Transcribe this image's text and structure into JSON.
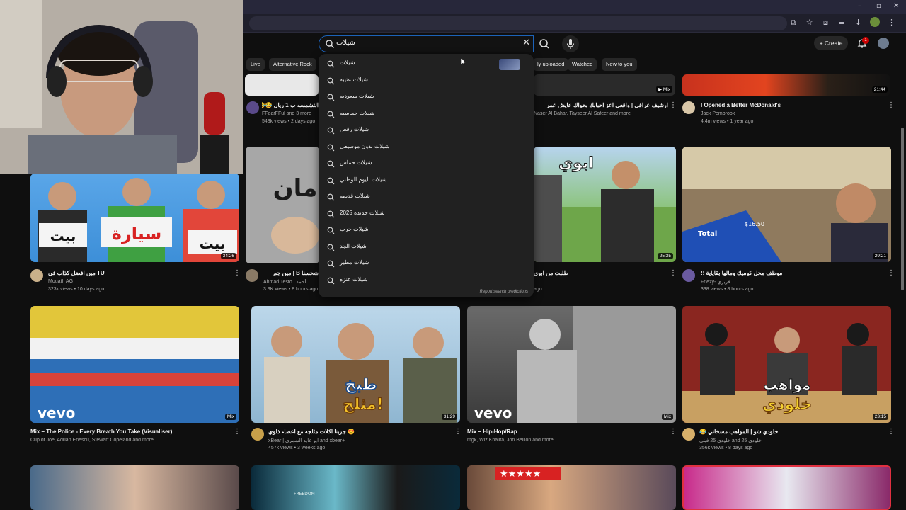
{
  "header": {
    "search_query": "شيلات",
    "create_label": "Create",
    "notification_count": "1"
  },
  "chips": [
    "Live",
    "Alternative Rock",
    "ly uploaded",
    "Watched",
    "New to you"
  ],
  "suggestions": [
    "شيلات",
    "شيلات عتيبه",
    "شيلات سعوديه",
    "شيلات حماسيه",
    "شيلات رقص",
    "شيلات بدون موسيقى",
    "شيلات حماس",
    "شيلات اليوم الوطني",
    "شيلات قديمه",
    "شيلات جديده 2025",
    "شيلات حرب",
    "شيلات الجد",
    "شيلات مطير",
    "شيلات عنزه"
  ],
  "report_label": "Report search predictions",
  "row1": [
    {
      "title": "التشمسه ب 1 ريال 😂😂",
      "channel": "FFearFFul and 3 more",
      "meta": "543k views • 2 days ago"
    },
    {
      "title": "ارشيف عراقي | واقعي اعز احبابك بحواك عايش عمر",
      "channel": "Naser Al Bahar, Tayseer Al Safeer and more",
      "meta": ""
    },
    {
      "title": "I Opened a Better McDonald's",
      "channel": "Jack Pembrook",
      "meta": "4.4m views • 1 year ago"
    }
  ],
  "row2": [
    {
      "title": "مين افضل كذاب في TU",
      "channel": "Mouath AG",
      "meta": "323k views • 10 days ago",
      "duration": "34:26"
    },
    {
      "title": "شحسنا B | مين جم",
      "channel": "Ahmad Testo | أحمد",
      "meta": "3.9K views • 8 hours ago"
    },
    {
      "title": "طلبت من ابوي",
      "channel": "",
      "meta": "ago",
      "duration": "25:35"
    },
    {
      "title": "موظف محل كوميك ومالها بقاياية !!",
      "channel": "Friezy- فريزي",
      "meta": "338 views • 8 hours ago",
      "duration": "29:21"
    }
  ],
  "row3": [
    {
      "title": "Mix – The Police - Every Breath You Take (Visualiser)",
      "channel": "Cup of Joe, Adrian Enescu, Stewart Copeland and more",
      "meta": "",
      "badge": "Mix"
    },
    {
      "title": "😍 جربنا اكلات مثلجه مع اعضاء ذلوي",
      "channel": "xBear | ابو عابد الشمري and xbear+",
      "meta": "457k views • 3 weeks ago",
      "duration": "31:29"
    },
    {
      "title": "Mix – Hip-Hop/Rap",
      "channel": "mgk, Wiz Khalifa, Jon Bellion and more",
      "meta": "",
      "badge": "Mix"
    },
    {
      "title": "خلودي شو | المواهب مسخاني 😂",
      "channel": "خلودي 25 فيني and 25 خلودي",
      "meta": "356k views • 8 days ago",
      "duration": "23:15"
    }
  ],
  "thumb_texts": {
    "bait": "بيت",
    "sayara": "سيارة",
    "abui": "ابوي",
    "total": "Total",
    "price": "$16.50",
    "tabkh": "طبخ",
    "mthallaj": "مثلج!",
    "mawahib": "مواهب",
    "kholoudi": "خلودي",
    "vevo": "vevo",
    "freedom": "FREEDOM"
  },
  "colors": {
    "accent": "#1c62b9",
    "badge": "#cc0000"
  }
}
